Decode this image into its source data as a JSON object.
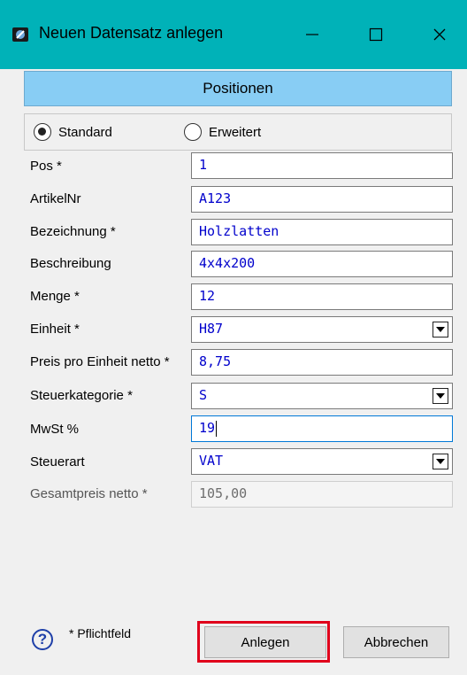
{
  "window": {
    "title": "Neuen Datensatz anlegen",
    "icon": "app-icon",
    "controls": [
      "minimize-icon",
      "maximize-icon",
      "close-icon"
    ]
  },
  "section": {
    "title": "Positionen"
  },
  "mode": {
    "options": [
      "Standard",
      "Erweitert"
    ],
    "selected": "Standard"
  },
  "fields": [
    {
      "label": "Pos *",
      "value": "1",
      "type": "text"
    },
    {
      "label": "ArtikelNr",
      "value": "A123",
      "type": "text"
    },
    {
      "label": "Bezeichnung *",
      "value": "Holzlatten",
      "type": "text"
    },
    {
      "label": "Beschreibung",
      "value": "4x4x200",
      "type": "text"
    },
    {
      "label": "Menge *",
      "value": "12",
      "type": "text"
    },
    {
      "label": "Einheit *",
      "value": "H87",
      "type": "dropdown"
    },
    {
      "label": "Preis pro Einheit netto *",
      "value": "8,75",
      "type": "text"
    },
    {
      "label": "Steuerkategorie *",
      "value": "S",
      "type": "dropdown"
    },
    {
      "label": "MwSt %",
      "value": "19",
      "type": "text",
      "focused": true
    },
    {
      "label": "Steuerart",
      "value": "VAT",
      "type": "dropdown"
    },
    {
      "label": "Gesamtpreis netto *",
      "value": "105,00",
      "type": "text",
      "disabled": true
    }
  ],
  "footer": {
    "help_icon": "help-icon",
    "required_note": "* Pflichtfeld",
    "create_label": "Anlegen",
    "cancel_label": "Abbrechen"
  },
  "colors": {
    "titlebar": "#00b2b8",
    "section_header": "#88cdf4",
    "input_text": "#0000cc",
    "focus_border": "#0078d7",
    "highlight": "#e0001b"
  }
}
